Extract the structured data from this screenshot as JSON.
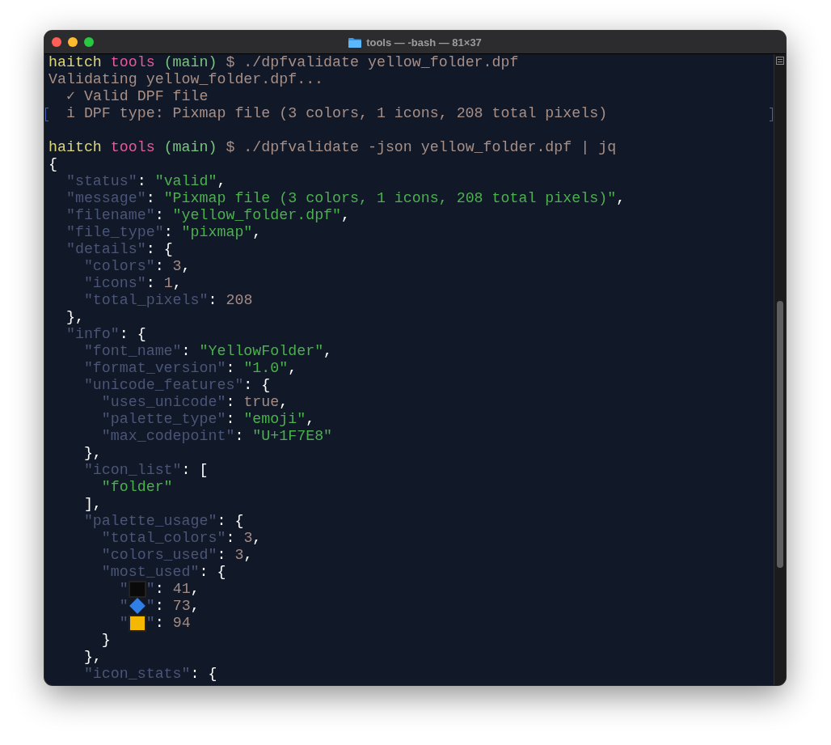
{
  "window": {
    "title": "tools — -bash — 81×37"
  },
  "lines": [
    {
      "marked": false,
      "segments": [
        {
          "kind": "user",
          "text": "haitch"
        },
        {
          "kind": "dir",
          "text": " tools"
        },
        {
          "kind": "branch",
          "text": " (main)"
        },
        {
          "kind": "command",
          "text": " $ ./dpfvalidate yellow_folder.dpf"
        }
      ]
    },
    {
      "marked": false,
      "segments": [
        {
          "kind": "output",
          "text": "Validating yellow_folder.dpf..."
        }
      ]
    },
    {
      "marked": false,
      "segments": [
        {
          "kind": "output",
          "text": "  ✓ Valid DPF file"
        }
      ]
    },
    {
      "marked": true,
      "segments": [
        {
          "kind": "output",
          "text": "  i DPF type: Pixmap file (3 colors, 1 icons, 208 total pixels)"
        }
      ]
    },
    {
      "marked": false
    },
    {
      "marked": false,
      "segments": [
        {
          "kind": "user",
          "text": "haitch"
        },
        {
          "kind": "dir",
          "text": " tools"
        },
        {
          "kind": "branch",
          "text": " (main)"
        },
        {
          "kind": "command",
          "text": " $ ./dpfvalidate -json yellow_folder.dpf | jq"
        }
      ]
    },
    {
      "marked": false,
      "segments": [
        {
          "kind": "punct",
          "text": "{"
        }
      ]
    },
    {
      "marked": false,
      "segments": [
        {
          "kind": "key",
          "text": "  \"status\""
        },
        {
          "kind": "punct",
          "text": ": "
        },
        {
          "kind": "string",
          "text": "\"valid\""
        },
        {
          "kind": "punct",
          "text": ","
        }
      ]
    },
    {
      "marked": false,
      "segments": [
        {
          "kind": "key",
          "text": "  \"message\""
        },
        {
          "kind": "punct",
          "text": ": "
        },
        {
          "kind": "string",
          "text": "\"Pixmap file (3 colors, 1 icons, 208 total pixels)\""
        },
        {
          "kind": "punct",
          "text": ","
        }
      ]
    },
    {
      "marked": false,
      "segments": [
        {
          "kind": "key",
          "text": "  \"filename\""
        },
        {
          "kind": "punct",
          "text": ": "
        },
        {
          "kind": "string",
          "text": "\"yellow_folder.dpf\""
        },
        {
          "kind": "punct",
          "text": ","
        }
      ]
    },
    {
      "marked": false,
      "segments": [
        {
          "kind": "key",
          "text": "  \"file_type\""
        },
        {
          "kind": "punct",
          "text": ": "
        },
        {
          "kind": "string",
          "text": "\"pixmap\""
        },
        {
          "kind": "punct",
          "text": ","
        }
      ]
    },
    {
      "marked": false,
      "segments": [
        {
          "kind": "key",
          "text": "  \"details\""
        },
        {
          "kind": "punct",
          "text": ": {"
        }
      ]
    },
    {
      "marked": false,
      "segments": [
        {
          "kind": "key",
          "text": "    \"colors\""
        },
        {
          "kind": "punct",
          "text": ": "
        },
        {
          "kind": "number",
          "text": "3"
        },
        {
          "kind": "punct",
          "text": ","
        }
      ]
    },
    {
      "marked": false,
      "segments": [
        {
          "kind": "key",
          "text": "    \"icons\""
        },
        {
          "kind": "punct",
          "text": ": "
        },
        {
          "kind": "number",
          "text": "1"
        },
        {
          "kind": "punct",
          "text": ","
        }
      ]
    },
    {
      "marked": false,
      "segments": [
        {
          "kind": "key",
          "text": "    \"total_pixels\""
        },
        {
          "kind": "punct",
          "text": ": "
        },
        {
          "kind": "number",
          "text": "208"
        }
      ]
    },
    {
      "marked": false,
      "segments": [
        {
          "kind": "punct",
          "text": "  },"
        }
      ]
    },
    {
      "marked": false,
      "segments": [
        {
          "kind": "key",
          "text": "  \"info\""
        },
        {
          "kind": "punct",
          "text": ": {"
        }
      ]
    },
    {
      "marked": false,
      "segments": [
        {
          "kind": "key",
          "text": "    \"font_name\""
        },
        {
          "kind": "punct",
          "text": ": "
        },
        {
          "kind": "string",
          "text": "\"YellowFolder\""
        },
        {
          "kind": "punct",
          "text": ","
        }
      ]
    },
    {
      "marked": false,
      "segments": [
        {
          "kind": "key",
          "text": "    \"format_version\""
        },
        {
          "kind": "punct",
          "text": ": "
        },
        {
          "kind": "string",
          "text": "\"1.0\""
        },
        {
          "kind": "punct",
          "text": ","
        }
      ]
    },
    {
      "marked": false,
      "segments": [
        {
          "kind": "key",
          "text": "    \"unicode_features\""
        },
        {
          "kind": "punct",
          "text": ": {"
        }
      ]
    },
    {
      "marked": false,
      "segments": [
        {
          "kind": "key",
          "text": "      \"uses_unicode\""
        },
        {
          "kind": "punct",
          "text": ": "
        },
        {
          "kind": "number",
          "text": "true"
        },
        {
          "kind": "punct",
          "text": ","
        }
      ]
    },
    {
      "marked": false,
      "segments": [
        {
          "kind": "key",
          "text": "      \"palette_type\""
        },
        {
          "kind": "punct",
          "text": ": "
        },
        {
          "kind": "string",
          "text": "\"emoji\""
        },
        {
          "kind": "punct",
          "text": ","
        }
      ]
    },
    {
      "marked": false,
      "segments": [
        {
          "kind": "key",
          "text": "      \"max_codepoint\""
        },
        {
          "kind": "punct",
          "text": ": "
        },
        {
          "kind": "string",
          "text": "\"U+1F7E8\""
        }
      ]
    },
    {
      "marked": false,
      "segments": [
        {
          "kind": "punct",
          "text": "    },"
        }
      ]
    },
    {
      "marked": false,
      "segments": [
        {
          "kind": "key",
          "text": "    \"icon_list\""
        },
        {
          "kind": "punct",
          "text": ": ["
        }
      ]
    },
    {
      "marked": false,
      "segments": [
        {
          "kind": "string",
          "text": "      \"folder\""
        }
      ]
    },
    {
      "marked": false,
      "segments": [
        {
          "kind": "punct",
          "text": "    ],"
        }
      ]
    },
    {
      "marked": false,
      "segments": [
        {
          "kind": "key",
          "text": "    \"palette_usage\""
        },
        {
          "kind": "punct",
          "text": ": {"
        }
      ]
    },
    {
      "marked": false,
      "segments": [
        {
          "kind": "key",
          "text": "      \"total_colors\""
        },
        {
          "kind": "punct",
          "text": ": "
        },
        {
          "kind": "number",
          "text": "3"
        },
        {
          "kind": "punct",
          "text": ","
        }
      ]
    },
    {
      "marked": false,
      "segments": [
        {
          "kind": "key",
          "text": "      \"colors_used\""
        },
        {
          "kind": "punct",
          "text": ": "
        },
        {
          "kind": "number",
          "text": "3"
        },
        {
          "kind": "punct",
          "text": ","
        }
      ]
    },
    {
      "marked": false,
      "segments": [
        {
          "kind": "key",
          "text": "      \"most_used\""
        },
        {
          "kind": "punct",
          "text": ": {"
        }
      ]
    },
    {
      "marked": false,
      "segments": [
        {
          "kind": "key",
          "text": "        \""
        },
        {
          "kind": "square",
          "color": "#0a0a0a"
        },
        {
          "kind": "key",
          "text": "\""
        },
        {
          "kind": "punct",
          "text": ": "
        },
        {
          "kind": "number",
          "text": "41"
        },
        {
          "kind": "punct",
          "text": ","
        }
      ]
    },
    {
      "marked": false,
      "segments": [
        {
          "kind": "key",
          "text": "        \""
        },
        {
          "kind": "diamond",
          "color": "#2f7fe6"
        },
        {
          "kind": "key",
          "text": "\""
        },
        {
          "kind": "punct",
          "text": ": "
        },
        {
          "kind": "number",
          "text": "73"
        },
        {
          "kind": "punct",
          "text": ","
        }
      ]
    },
    {
      "marked": false,
      "segments": [
        {
          "kind": "key",
          "text": "        \""
        },
        {
          "kind": "square",
          "color": "#f5b800"
        },
        {
          "kind": "key",
          "text": "\""
        },
        {
          "kind": "punct",
          "text": ": "
        },
        {
          "kind": "number",
          "text": "94"
        }
      ]
    },
    {
      "marked": false,
      "segments": [
        {
          "kind": "punct",
          "text": "      }"
        }
      ]
    },
    {
      "marked": false,
      "segments": [
        {
          "kind": "punct",
          "text": "    },"
        }
      ]
    },
    {
      "marked": false,
      "segments": [
        {
          "kind": "key",
          "text": "    \"icon_stats\""
        },
        {
          "kind": "punct",
          "text": ": {"
        }
      ]
    }
  ]
}
